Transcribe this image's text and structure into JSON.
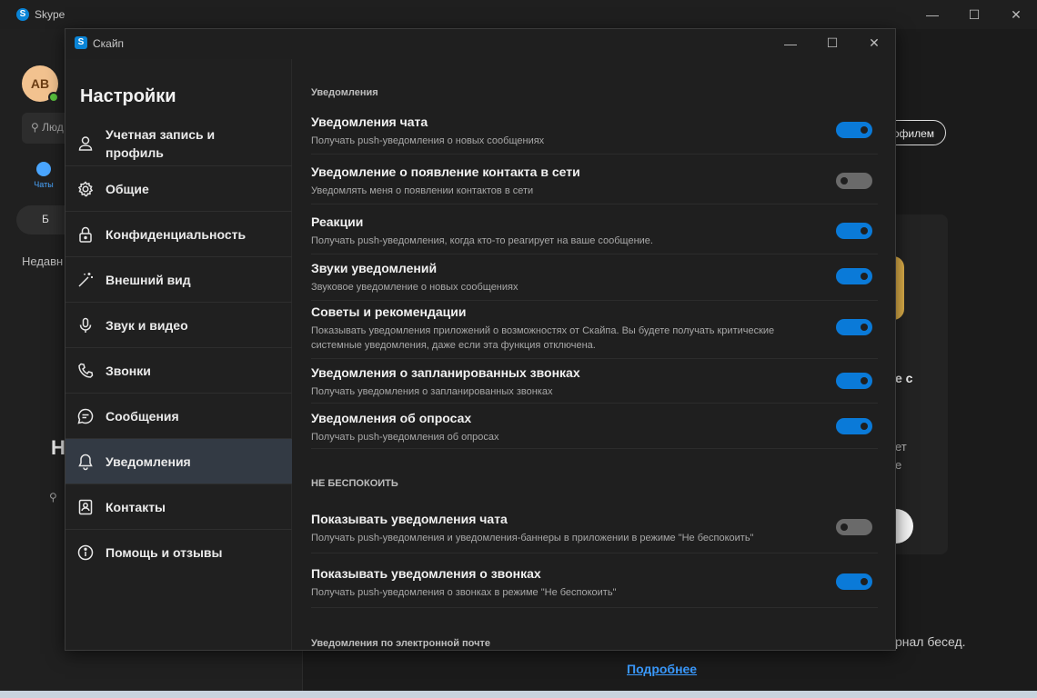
{
  "main_window": {
    "title": "Skype",
    "avatar_initials": "AB",
    "search_placeholder": "Люд",
    "chats_tab": "Чаты",
    "meet_button": "Б",
    "recent_label": "Недавн",
    "big_heading_fragment": "Н",
    "profile_button_fragment": "офилем",
    "card_fragment_1": "е с",
    "card_fragment_2": "ет",
    "card_fragment_3": "е",
    "journal_fragment": "рнал бесед.",
    "more_link": "Подробнее"
  },
  "settings": {
    "window_title": "Скайп",
    "heading": "Настройки",
    "nav": [
      {
        "label": "Учетная запись и профиль",
        "icon": "person-icon",
        "active": false
      },
      {
        "label": "Общие",
        "icon": "gear-icon",
        "active": false
      },
      {
        "label": "Конфиденциальность",
        "icon": "lock-icon",
        "active": false
      },
      {
        "label": "Внешний вид",
        "icon": "magic-wand-icon",
        "active": false
      },
      {
        "label": "Звук и видео",
        "icon": "microphone-icon",
        "active": false
      },
      {
        "label": "Звонки",
        "icon": "phone-icon",
        "active": false
      },
      {
        "label": "Сообщения",
        "icon": "chat-bubble-icon",
        "active": false
      },
      {
        "label": "Уведомления",
        "icon": "bell-icon",
        "active": true
      },
      {
        "label": "Контакты",
        "icon": "contacts-icon",
        "active": false
      },
      {
        "label": "Помощь и отзывы",
        "icon": "info-icon",
        "active": false
      }
    ],
    "section_notifications": "Уведомления",
    "notifications": [
      {
        "title": "Уведомления чата",
        "desc": "Получать push-уведомления о новых сообщениях",
        "on": true
      },
      {
        "title": "Уведомление о появление контакта в сети",
        "desc": "Уведомлять меня о появлении контактов в сети",
        "on": false
      },
      {
        "title": "Реакции",
        "desc": "Получать push-уведомления, когда кто-то реагирует на ваше сообщение.",
        "on": true
      },
      {
        "title": "Звуки уведомлений",
        "desc": "Звуковое уведомление о новых сообщениях",
        "on": true
      },
      {
        "title": "Советы и рекомендации",
        "desc": "Показывать уведомления приложений о возможностях от Скайпа. Вы будете получать критические системные уведомления, даже если эта функция отключена.",
        "on": true
      },
      {
        "title": "Уведомления о запланированных звонках",
        "desc": "Получать уведомления о запланированных звонках",
        "on": true
      },
      {
        "title": "Уведомления об опросах",
        "desc": "Получать push-уведомления об опросах",
        "on": true
      }
    ],
    "section_dnd": "НЕ БЕСПОКОИТЬ",
    "dnd": [
      {
        "title": "Показывать уведомления чата",
        "desc": "Получать push-уведомления и уведомления-баннеры в приложении в режиме \"Не беспокоить\"",
        "on": false
      },
      {
        "title": "Показывать уведомления о звонках",
        "desc": "Получать push-уведомления о звонках в режиме \"Не беспокоить\"",
        "on": true
      }
    ],
    "section_email": "Уведомления по электронной почте"
  }
}
